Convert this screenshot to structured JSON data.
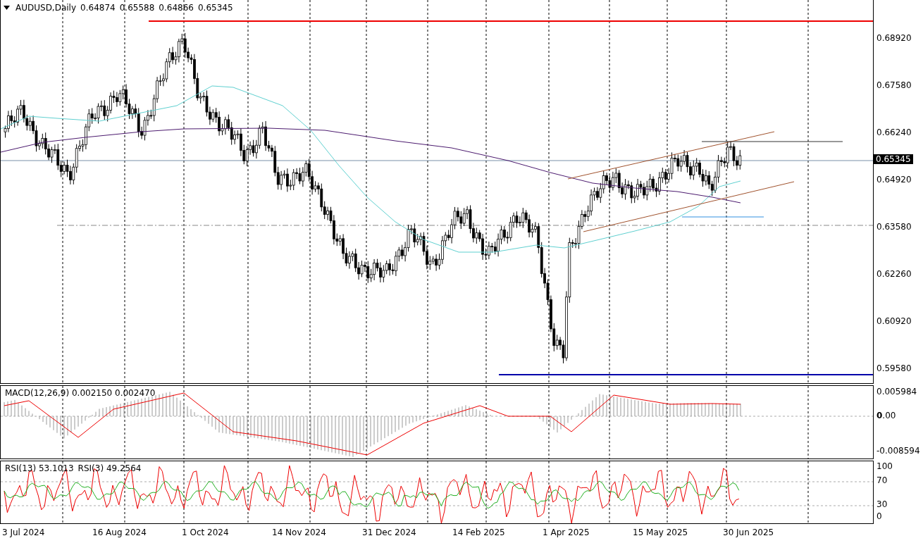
{
  "header": {
    "symbol": "AUDUSD,Daily",
    "ohlc": [
      "0.64874",
      "0.65588",
      "0.64866",
      "0.65345"
    ]
  },
  "price_axis": {
    "ticks": [
      "0.68920",
      "0.67580",
      "0.66240",
      "0.64920",
      "0.63580",
      "0.62260",
      "0.60920",
      "0.59580"
    ],
    "current_price": "0.65345"
  },
  "macd": {
    "label": "MACD(12,26,9)",
    "values": [
      "0.002150",
      "0.002470"
    ],
    "ticks": [
      "0.005984",
      "**0**.00",
      "-0.008594"
    ]
  },
  "rsi": {
    "labels": [
      "RSI(13) 53.1013",
      "RSI(3) 49.2564"
    ],
    "ticks": [
      "100",
      "70",
      "30",
      "0"
    ]
  },
  "dates": [
    "3 Jul 2024",
    "16 Aug 2024",
    "1 Oct 2024",
    "14 Nov 2024",
    "31 Dec 2024",
    "14 Feb 2025",
    "1 Apr 2025",
    "15 May 2025",
    "30 Jun 2025"
  ]
}
